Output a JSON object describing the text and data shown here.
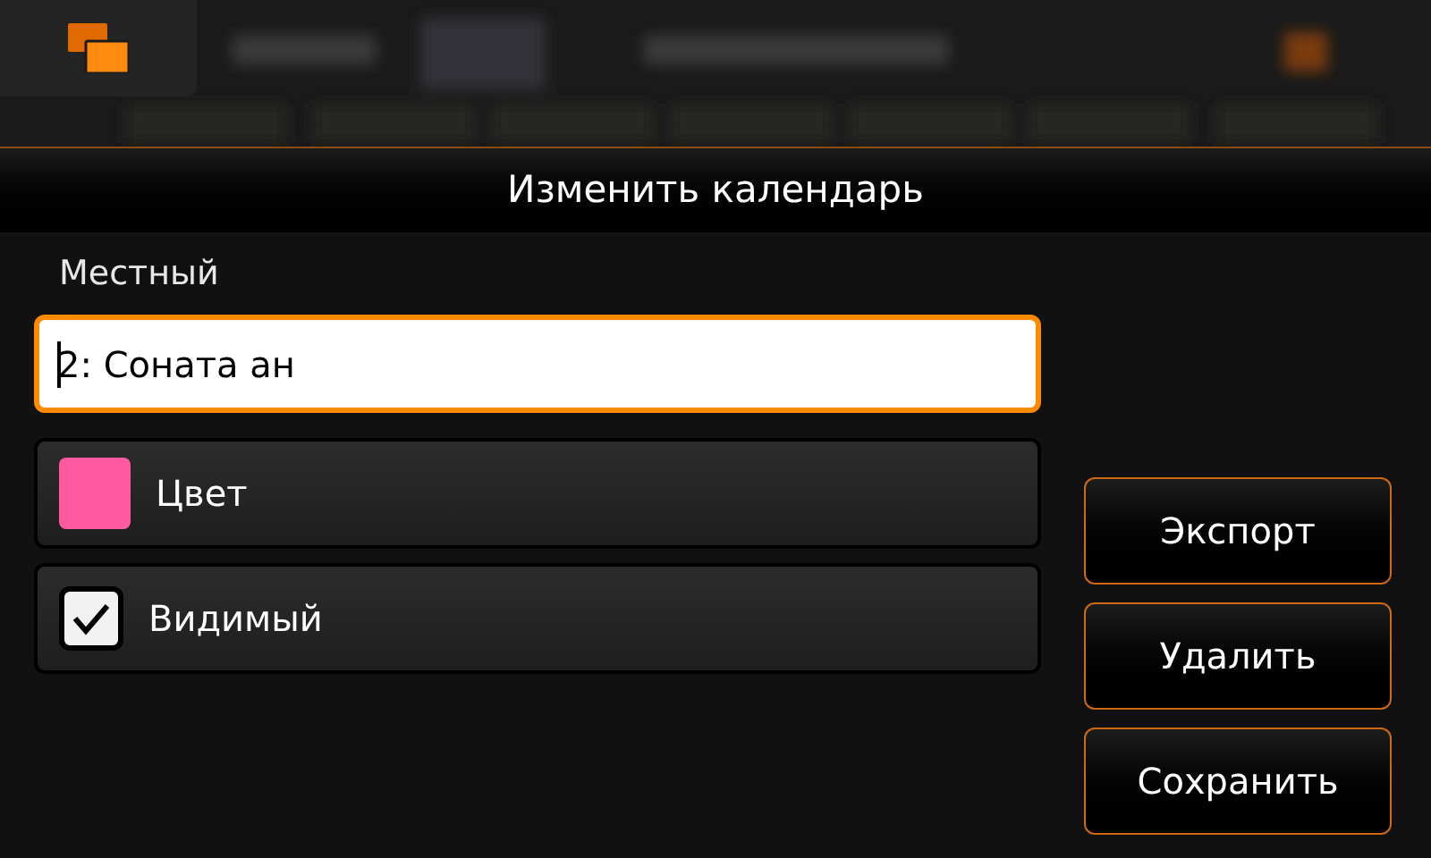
{
  "dialog": {
    "title": "Изменить календарь"
  },
  "section_label": "Местный",
  "name_field": {
    "value": "2: Соната ан",
    "focused": true
  },
  "rows": [
    {
      "kind": "color",
      "label": "Цвет",
      "color": "#ff5aa0"
    },
    {
      "kind": "checkbox",
      "label": "Видимый",
      "checked": true
    }
  ],
  "buttons": [
    "Экспорт",
    "Удалить",
    "Сохранить"
  ]
}
